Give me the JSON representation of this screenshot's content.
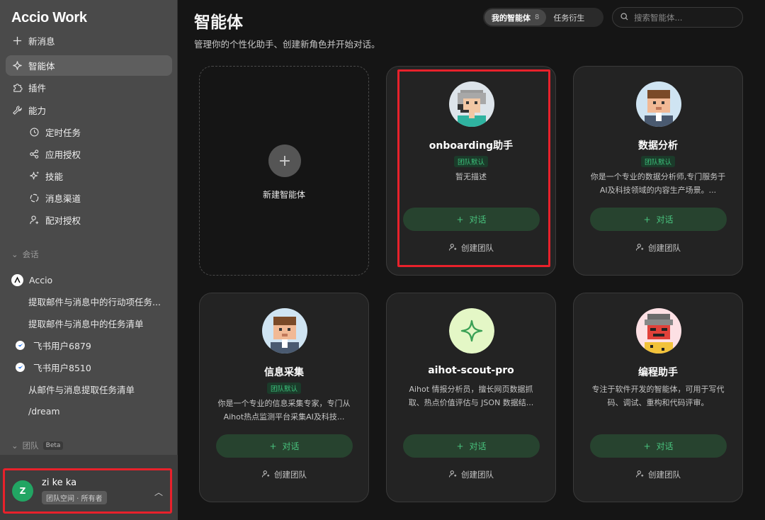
{
  "sidebar": {
    "logo": "Accio Work",
    "items": [
      {
        "label": "新消息"
      },
      {
        "label": "智能体"
      },
      {
        "label": "插件"
      },
      {
        "label": "能力"
      },
      {
        "label": "定时任务"
      },
      {
        "label": "应用授权"
      },
      {
        "label": "技能"
      },
      {
        "label": "消息渠道"
      },
      {
        "label": "配对授权"
      }
    ],
    "sessions_label": "会话",
    "conversations": [
      {
        "label": "Accio"
      },
      {
        "label": "提取邮件与消息中的行动项任务..."
      },
      {
        "label": "提取邮件与消息中的任务清单"
      },
      {
        "label": "飞书用户6879"
      },
      {
        "label": "飞书用户8510"
      },
      {
        "label": "从邮件与消息提取任务清单"
      },
      {
        "label": "/dream"
      }
    ],
    "team_label": "团队",
    "team_beta": "Beta"
  },
  "user": {
    "initial": "Z",
    "name": "zi ke ka",
    "tag": "团队空间 · 所有者"
  },
  "header": {
    "title": "智能体",
    "subtitle": "管理你的个性化助手、创建新角色并开始对话。",
    "tab_my": "我的智能体",
    "tab_my_count": "8",
    "tab_derived": "任务衍生",
    "search_placeholder": "搜索智能体..."
  },
  "new_agent_label": "新建智能体",
  "cards": [
    {
      "name": "onboarding助手",
      "badge": "团队默认",
      "desc": "暂无描述",
      "chat": "对话",
      "team": "创建团队",
      "avatar": "grey-hair-headset-avatar"
    },
    {
      "name": "数据分析",
      "badge": "团队默认",
      "desc": "你是一个专业的数据分析师,专门服务于AI及科技领域的内容生产场景。...",
      "chat": "对话",
      "team": "创建团队",
      "avatar": "brown-hair-suit-avatar"
    },
    {
      "name": "信息采集",
      "badge": "团队默认",
      "desc": "你是一个专业的信息采集专家，专门从Aihot热点监测平台采集AI及科技...",
      "chat": "对话",
      "team": "创建团队",
      "avatar": "brown-hair-suit-avatar"
    },
    {
      "name": "aihot-scout-pro",
      "badge": "",
      "desc": "Aihot 情报分析员，擅长网页数据抓取、热点价值评估与 JSON 数据结...",
      "chat": "对话",
      "team": "创建团队",
      "avatar": "sparkle-icon"
    },
    {
      "name": "编程助手",
      "badge": "",
      "desc": "专注于软件开发的智能体，可用于写代码、调试、重构和代码评审。",
      "chat": "对话",
      "team": "创建团队",
      "avatar": "robot-avatar"
    }
  ],
  "colors": {
    "accent_green": "#48c27d",
    "highlight_red": "#e8212b",
    "avatar_green": "#22a563"
  }
}
